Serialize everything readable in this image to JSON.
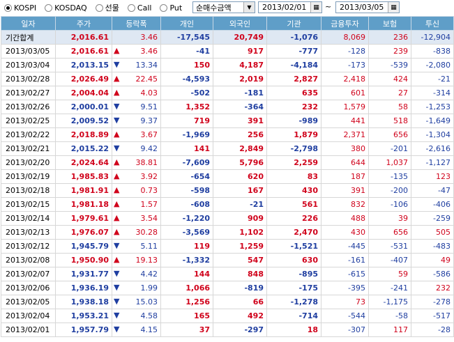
{
  "market_options": [
    {
      "label": "KOSPI",
      "selected": true
    },
    {
      "label": "KOSDAQ",
      "selected": false
    },
    {
      "label": "선물",
      "selected": false
    },
    {
      "label": "Call",
      "selected": false
    },
    {
      "label": "Put",
      "selected": false
    }
  ],
  "filter": {
    "value": "순매수금액"
  },
  "date_from": "2013/02/01",
  "date_to": "2013/03/05",
  "tilde": "~",
  "colors": {
    "header_bg": "#5f9ec8",
    "up": "#d0021b",
    "down": "#1f3ea0",
    "sum_bg": "#dfe8f3"
  },
  "columns": [
    "일자",
    "주가",
    "등락폭",
    "개인",
    "외국인",
    "기관",
    "금융투자",
    "보험",
    "투신"
  ],
  "rows": [
    {
      "date": "기간합계",
      "price": "2,016.61",
      "dir": "",
      "change": "3.46",
      "indiv": "-17,545",
      "foreign": "20,749",
      "inst": "-1,076",
      "fin": "8,069",
      "ins": "236",
      "trust": "-12,904"
    },
    {
      "date": "2013/03/05",
      "price": "2,016.61",
      "dir": "up",
      "change": "3.46",
      "indiv": "-41",
      "foreign": "917",
      "inst": "-777",
      "fin": "-128",
      "ins": "239",
      "trust": "-838"
    },
    {
      "date": "2013/03/04",
      "price": "2,013.15",
      "dir": "dn",
      "change": "13.34",
      "indiv": "150",
      "foreign": "4,187",
      "inst": "-4,184",
      "fin": "-173",
      "ins": "-539",
      "trust": "-2,080"
    },
    {
      "date": "2013/02/28",
      "price": "2,026.49",
      "dir": "up",
      "change": "22.45",
      "indiv": "-4,593",
      "foreign": "2,019",
      "inst": "2,827",
      "fin": "2,418",
      "ins": "424",
      "trust": "-21"
    },
    {
      "date": "2013/02/27",
      "price": "2,004.04",
      "dir": "up",
      "change": "4.03",
      "indiv": "-502",
      "foreign": "-181",
      "inst": "635",
      "fin": "601",
      "ins": "27",
      "trust": "-314"
    },
    {
      "date": "2013/02/26",
      "price": "2,000.01",
      "dir": "dn",
      "change": "9.51",
      "indiv": "1,352",
      "foreign": "-364",
      "inst": "232",
      "fin": "1,579",
      "ins": "58",
      "trust": "-1,253"
    },
    {
      "date": "2013/02/25",
      "price": "2,009.52",
      "dir": "dn",
      "change": "9.37",
      "indiv": "719",
      "foreign": "391",
      "inst": "-989",
      "fin": "441",
      "ins": "518",
      "trust": "-1,649"
    },
    {
      "date": "2013/02/22",
      "price": "2,018.89",
      "dir": "up",
      "change": "3.67",
      "indiv": "-1,969",
      "foreign": "256",
      "inst": "1,879",
      "fin": "2,371",
      "ins": "656",
      "trust": "-1,304"
    },
    {
      "date": "2013/02/21",
      "price": "2,015.22",
      "dir": "dn",
      "change": "9.42",
      "indiv": "141",
      "foreign": "2,849",
      "inst": "-2,798",
      "fin": "380",
      "ins": "-201",
      "trust": "-2,616"
    },
    {
      "date": "2013/02/20",
      "price": "2,024.64",
      "dir": "up",
      "change": "38.81",
      "indiv": "-7,609",
      "foreign": "5,796",
      "inst": "2,259",
      "fin": "644",
      "ins": "1,037",
      "trust": "-1,127"
    },
    {
      "date": "2013/02/19",
      "price": "1,985.83",
      "dir": "up",
      "change": "3.92",
      "indiv": "-654",
      "foreign": "620",
      "inst": "83",
      "fin": "187",
      "ins": "-135",
      "trust": "123"
    },
    {
      "date": "2013/02/18",
      "price": "1,981.91",
      "dir": "up",
      "change": "0.73",
      "indiv": "-598",
      "foreign": "167",
      "inst": "430",
      "fin": "391",
      "ins": "-200",
      "trust": "-47"
    },
    {
      "date": "2013/02/15",
      "price": "1,981.18",
      "dir": "up",
      "change": "1.57",
      "indiv": "-608",
      "foreign": "-21",
      "inst": "561",
      "fin": "832",
      "ins": "-106",
      "trust": "-406"
    },
    {
      "date": "2013/02/14",
      "price": "1,979.61",
      "dir": "up",
      "change": "3.54",
      "indiv": "-1,220",
      "foreign": "909",
      "inst": "226",
      "fin": "488",
      "ins": "39",
      "trust": "-259"
    },
    {
      "date": "2013/02/13",
      "price": "1,976.07",
      "dir": "up",
      "change": "30.28",
      "indiv": "-3,569",
      "foreign": "1,102",
      "inst": "2,470",
      "fin": "430",
      "ins": "656",
      "trust": "505"
    },
    {
      "date": "2013/02/12",
      "price": "1,945.79",
      "dir": "dn",
      "change": "5.11",
      "indiv": "119",
      "foreign": "1,259",
      "inst": "-1,521",
      "fin": "-445",
      "ins": "-531",
      "trust": "-483"
    },
    {
      "date": "2013/02/08",
      "price": "1,950.90",
      "dir": "up",
      "change": "19.13",
      "indiv": "-1,332",
      "foreign": "547",
      "inst": "630",
      "fin": "-161",
      "ins": "-407",
      "trust": "49"
    },
    {
      "date": "2013/02/07",
      "price": "1,931.77",
      "dir": "dn",
      "change": "4.42",
      "indiv": "144",
      "foreign": "848",
      "inst": "-895",
      "fin": "-615",
      "ins": "59",
      "trust": "-586"
    },
    {
      "date": "2013/02/06",
      "price": "1,936.19",
      "dir": "dn",
      "change": "1.99",
      "indiv": "1,066",
      "foreign": "-819",
      "inst": "-175",
      "fin": "-395",
      "ins": "-241",
      "trust": "232"
    },
    {
      "date": "2013/02/05",
      "price": "1,938.18",
      "dir": "dn",
      "change": "15.03",
      "indiv": "1,256",
      "foreign": "66",
      "inst": "-1,278",
      "fin": "73",
      "ins": "-1,175",
      "trust": "-278"
    },
    {
      "date": "2013/02/04",
      "price": "1,953.21",
      "dir": "dn",
      "change": "4.58",
      "indiv": "165",
      "foreign": "492",
      "inst": "-714",
      "fin": "-544",
      "ins": "-58",
      "trust": "-517"
    },
    {
      "date": "2013/02/01",
      "price": "1,957.79",
      "dir": "dn",
      "change": "4.15",
      "indiv": "37",
      "foreign": "-297",
      "inst": "18",
      "fin": "-307",
      "ins": "117",
      "trust": "-28"
    }
  ]
}
